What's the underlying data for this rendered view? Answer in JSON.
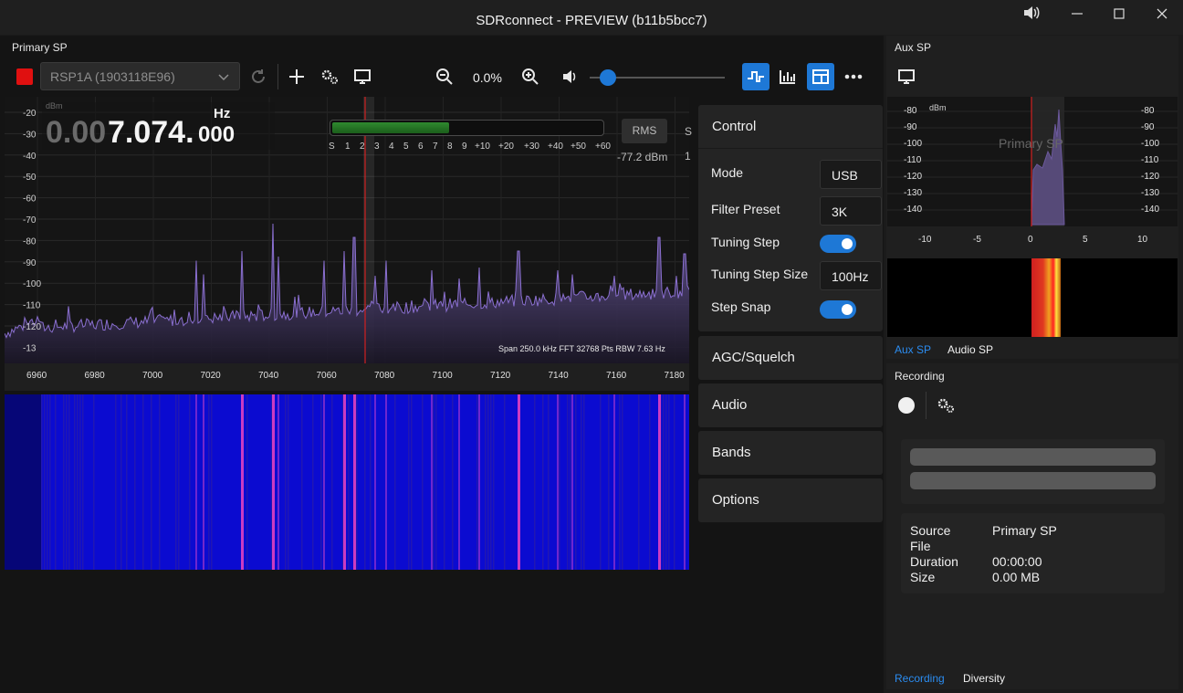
{
  "window": {
    "title": "SDRconnect - PREVIEW (b11b5bcc7)"
  },
  "primary": {
    "panel_title": "Primary SP",
    "device": "RSP1A (1903118E96)",
    "zoom": "0.0%",
    "volume_level": 0.02,
    "frequency": {
      "dim": "0.00",
      "main": "7.074.",
      "small": "000",
      "unit": "Hz"
    },
    "smeter": {
      "level": 0.43,
      "scale": [
        "S",
        "1",
        "2",
        "3",
        "4",
        "5",
        "6",
        "7",
        "8",
        "9",
        "+10",
        "+20",
        "+30",
        "+40",
        "+50",
        "+60"
      ],
      "mode": "RMS",
      "value": "-77.2 dBm"
    },
    "spectrum": {
      "unit": "dBm",
      "y_ticks": [
        "-20",
        "-30",
        "-40",
        "-50",
        "-60",
        "-70",
        "-80",
        "-90",
        "-100",
        "-110",
        "-120",
        "-13"
      ],
      "x_ticks": [
        "6960",
        "6980",
        "7000",
        "7020",
        "7040",
        "7060",
        "7080",
        "7100",
        "7120",
        "7140",
        "7160",
        "7180"
      ],
      "info": "Span 250.0 kHz FFT 32768 Pts  RBW 7.63 Hz",
      "trace_color": "#8a6fd0",
      "tuning_line_color": "#d02020"
    }
  },
  "control": {
    "sections": [
      "Control",
      "AGC/Squelch",
      "Audio",
      "Bands",
      "Options"
    ],
    "mode_label": "Mode",
    "mode_value": "USB",
    "filter_label": "Filter Preset",
    "filter_value": "3K",
    "tuning_step_label": "Tuning Step",
    "tuning_step_on": true,
    "tuning_step_size_label": "Tuning Step Size",
    "tuning_step_size_value": "100Hz",
    "step_snap_label": "Step Snap",
    "step_snap_on": true
  },
  "aux": {
    "panel_title": "Aux SP",
    "unit": "dBm",
    "watermark": "Primary SP",
    "y_ticks": [
      "-80",
      "-90",
      "-100",
      "-110",
      "-120",
      "-130",
      "-140"
    ],
    "x_ticks": [
      "-10",
      "-5",
      "0",
      "5",
      "10"
    ],
    "tabs": [
      "Aux SP",
      "Audio SP"
    ]
  },
  "recording": {
    "panel_title": "Recording",
    "source_label": "Source",
    "source_value": "Primary SP",
    "file_label": "File",
    "file_value": "",
    "duration_label": "Duration",
    "duration_value": "00:00:00",
    "size_label": "Size",
    "size_value": "0.00 MB",
    "tabs": [
      "Recording",
      "Diversity"
    ]
  },
  "colors": {
    "accent": "#1e78d6",
    "record": "#e01010",
    "waterfall_bg": "#0b0bd0"
  },
  "icons": [
    "stop-icon",
    "refresh-icon",
    "plus-icon",
    "settings-icon",
    "monitor-icon",
    "zoom-out-icon",
    "zoom-in-icon",
    "volume-icon",
    "waveform-icon",
    "bar-chart-icon",
    "split-view-icon",
    "more-icon",
    "record-icon"
  ]
}
